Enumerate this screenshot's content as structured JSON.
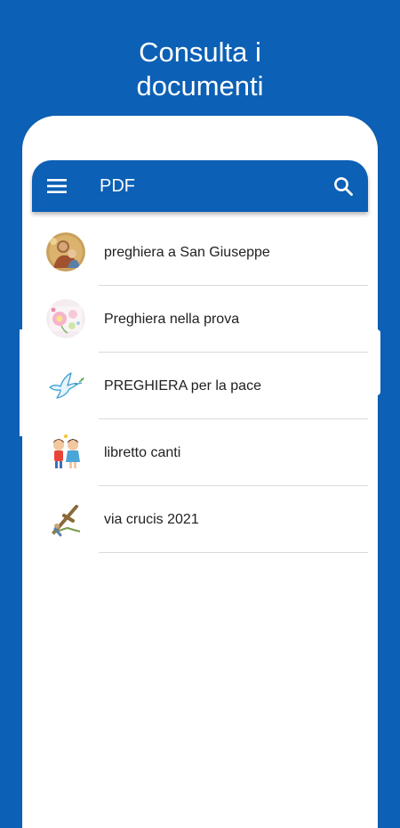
{
  "promo": {
    "title_line1": "Consulta i",
    "title_line2": "documenti"
  },
  "app_bar": {
    "title": "PDF",
    "menu_icon": "hamburger-menu-icon",
    "search_icon": "search-icon",
    "color": "#0c60b5"
  },
  "documents": [
    {
      "title": "preghiera a San Giuseppe",
      "thumb": "saint-joseph-painting"
    },
    {
      "title": "Preghiera nella prova",
      "thumb": "flowers-illustration"
    },
    {
      "title": "PREGHIERA per la pace",
      "thumb": "peace-dove-icon"
    },
    {
      "title": "libretto canti",
      "thumb": "children-singing-illustration"
    },
    {
      "title": "via crucis 2021",
      "thumb": "cross-illustration"
    }
  ],
  "colors": {
    "background": "#0c60b5",
    "surface": "#ffffff",
    "text": "#212121",
    "divider": "#dadada"
  }
}
